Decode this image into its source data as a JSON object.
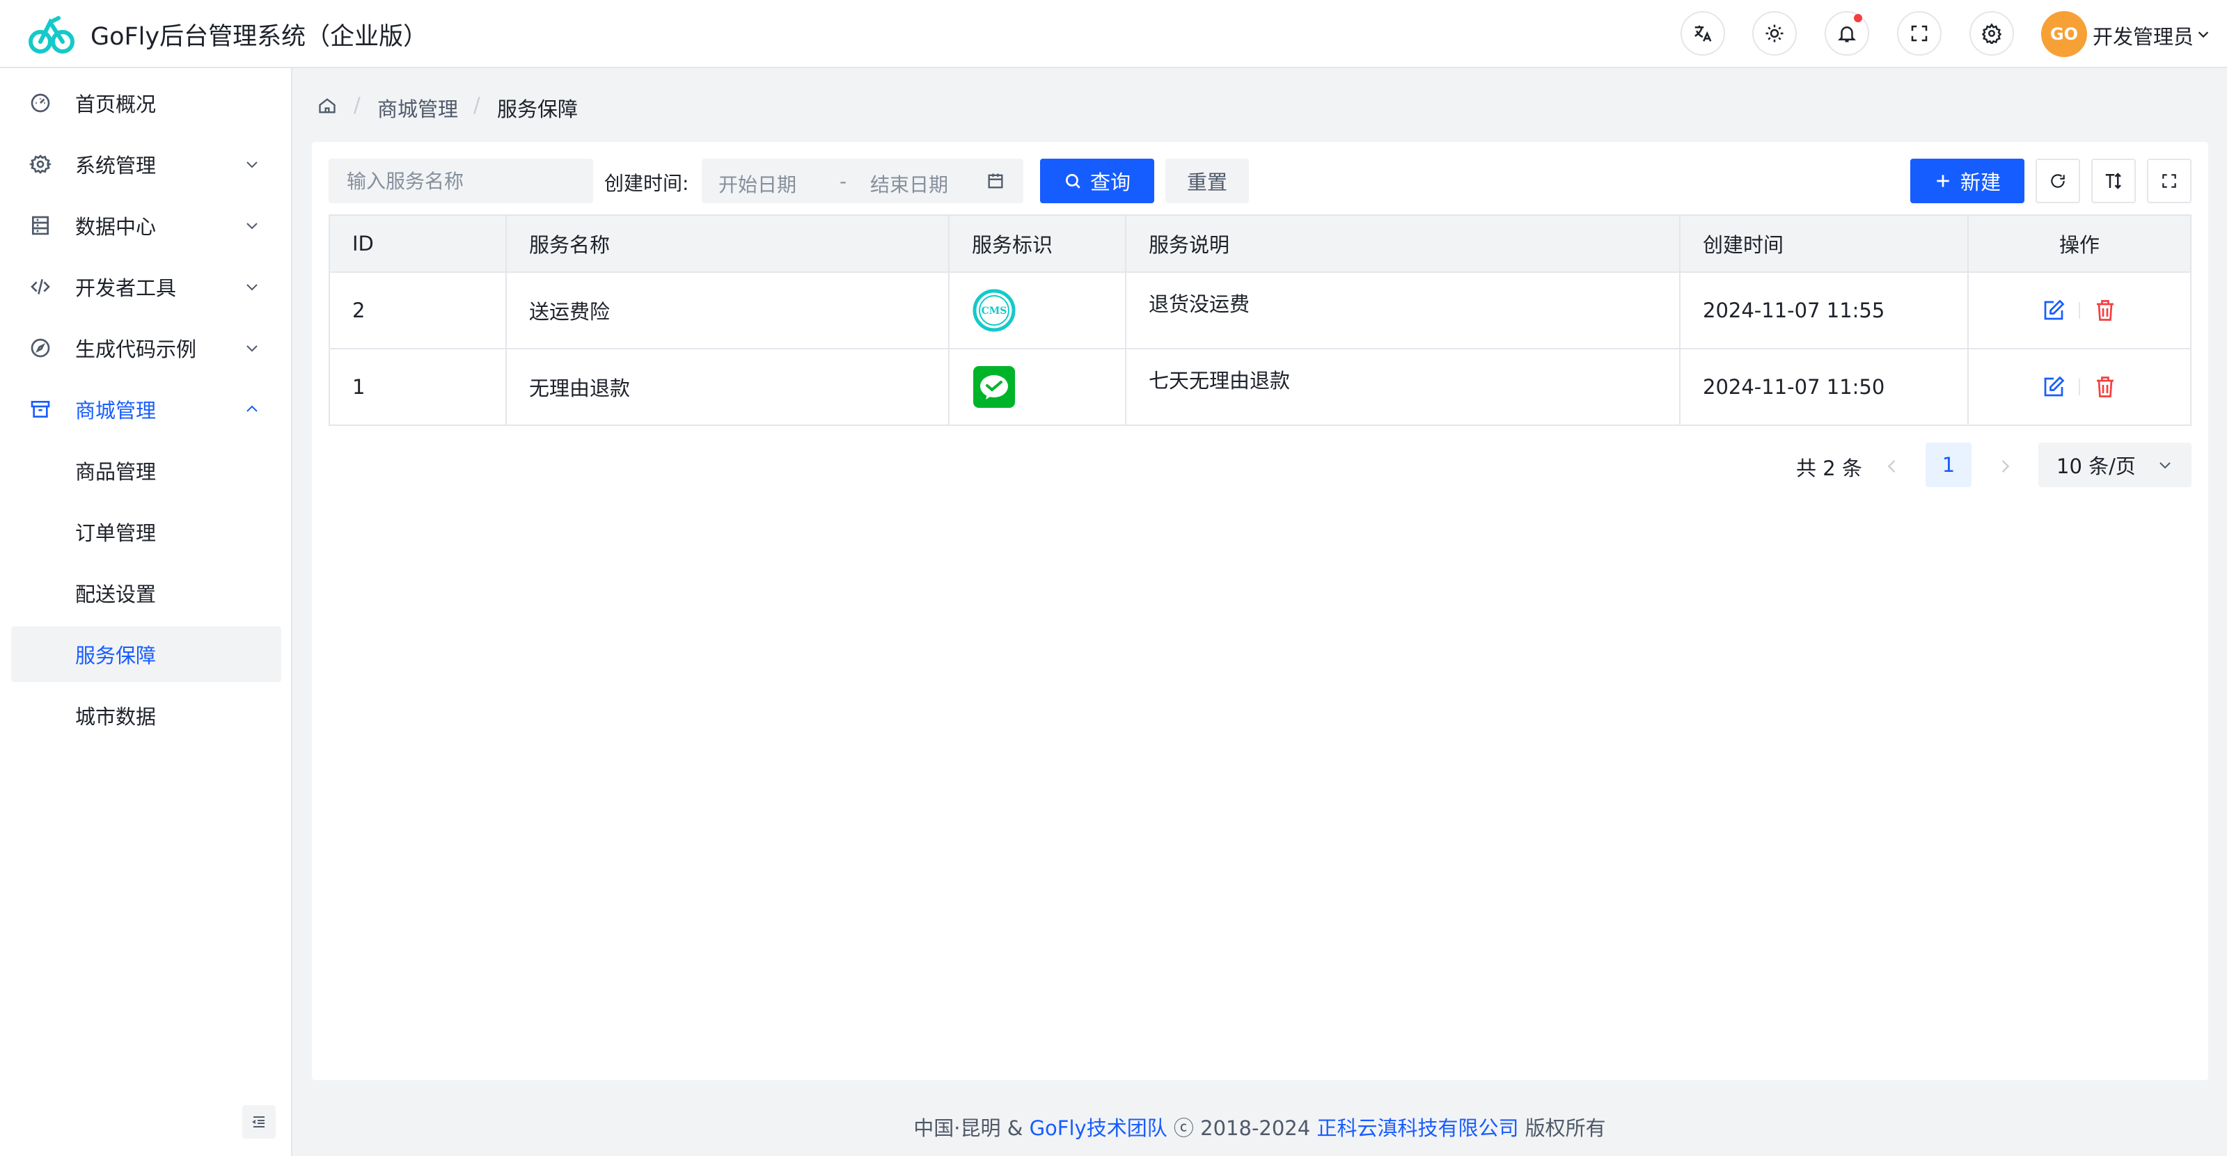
{
  "header": {
    "app_title": "GoFly后台管理系统（企业版）",
    "user_name": "开发管理员",
    "avatar_text": "GO",
    "icons": [
      "translate-icon",
      "theme-icon",
      "bell-icon",
      "fullscreen-icon",
      "settings-icon"
    ]
  },
  "sidebar": {
    "items": [
      {
        "label": "首页概况",
        "icon": "dashboard-icon"
      },
      {
        "label": "系统管理",
        "icon": "gear-icon"
      },
      {
        "label": "数据中心",
        "icon": "database-icon"
      },
      {
        "label": "开发者工具",
        "icon": "code-icon"
      },
      {
        "label": "生成代码示例",
        "icon": "compass-icon"
      },
      {
        "label": "商城管理",
        "icon": "store-icon"
      }
    ],
    "sub_items": [
      {
        "label": "商品管理"
      },
      {
        "label": "订单管理"
      },
      {
        "label": "配送设置"
      },
      {
        "label": "服务保障"
      },
      {
        "label": "城市数据"
      }
    ],
    "active_group": "商城管理",
    "selected_item": "服务保障"
  },
  "breadcrumb": {
    "sep": "/",
    "items": [
      "商城管理",
      "服务保障"
    ]
  },
  "filters": {
    "name_placeholder": "输入服务名称",
    "date_label": "创建时间:",
    "start_placeholder": "开始日期",
    "end_placeholder": "结束日期",
    "date_sep": "-",
    "query_label": "查询",
    "reset_label": "重置",
    "new_label": "新建"
  },
  "table": {
    "headers": [
      "ID",
      "服务名称",
      "服务标识",
      "服务说明",
      "创建时间",
      "操作"
    ],
    "rows": [
      {
        "id": "2",
        "name": "送运费险",
        "icon": "cms-icon",
        "desc": "退货没运费",
        "created": "2024-11-07 11:55"
      },
      {
        "id": "1",
        "name": "无理由退款",
        "icon": "wechat-pay-icon",
        "desc": "七天无理由退款",
        "created": "2024-11-07 11:50"
      }
    ]
  },
  "pagination": {
    "total": "共 2 条",
    "current": "1",
    "page_size": "10 条/页"
  },
  "footer": {
    "prefix": "中国·昆明 &",
    "team": "GoFly技术团队",
    "copy": "ⓒ 2018-2024",
    "company": "正科云滇科技有限公司",
    "suffix": "版权所有"
  },
  "colors": {
    "primary": "#165dff",
    "danger": "#f53f3f",
    "cms_teal": "#14c9c9",
    "wechat_green": "#00b42a"
  }
}
